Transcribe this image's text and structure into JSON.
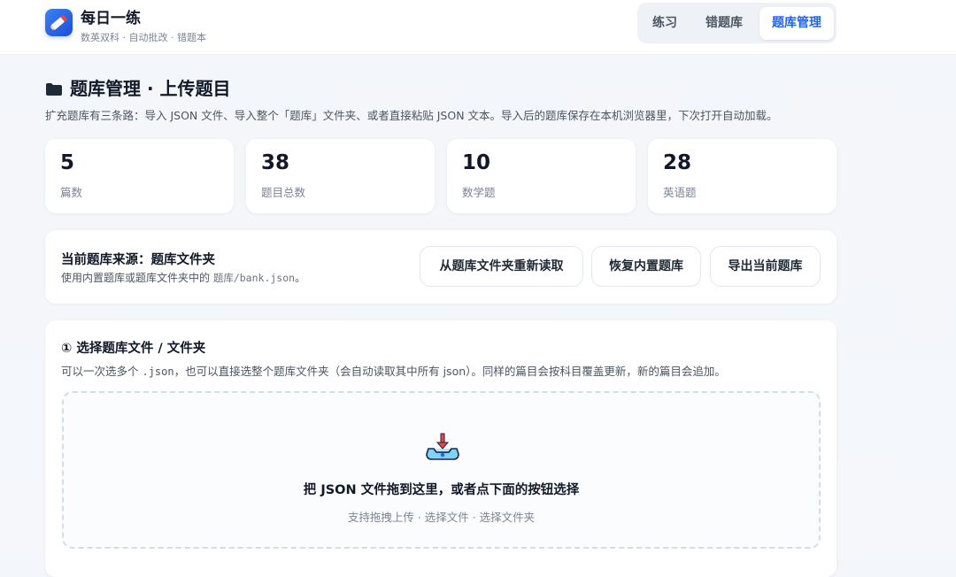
{
  "header": {
    "title": "每日一练",
    "subtitle": "数英双科 · 自动批改 · 错题本",
    "logo_icon": "pencil-icon",
    "tabs": [
      {
        "label": "练习",
        "active": false
      },
      {
        "label": "错题库",
        "active": false
      },
      {
        "label": "题库管理",
        "active": true
      }
    ]
  },
  "page": {
    "icon": "folder-icon",
    "title": "题库管理 · 上传题目",
    "description": "扩充题库有三条路：导入 JSON 文件、导入整个「题库」文件夹、或者直接粘贴 JSON 文本。导入后的题库保存在本机浏览器里，下次打开自动加载。"
  },
  "stats": [
    {
      "value": "5",
      "label": "篇数"
    },
    {
      "value": "38",
      "label": "题目总数"
    },
    {
      "value": "10",
      "label": "数学题"
    },
    {
      "value": "28",
      "label": "英语题"
    }
  ],
  "source": {
    "title": "当前题库来源：题库文件夹",
    "desc_prefix": "使用内置题库或题库文件夹中的 ",
    "desc_path": "题库/bank.json",
    "desc_suffix": "。",
    "buttons": {
      "reload": "从题库文件夹重新读取",
      "restore": "恢复内置题库",
      "export": "导出当前题库"
    }
  },
  "upload": {
    "title": "① 选择题库文件 / 文件夹",
    "desc_prefix": "可以一次选多个 ",
    "desc_ext": ".json",
    "desc_suffix": "，也可以直接选整个题库文件夹（会自动读取其中所有 json）。同样的篇目会按科目覆盖更新，新的篇目会追加。",
    "drop_icon": "inbox-download-icon",
    "drop_main": "把 JSON 文件拖到这里，或者点下面的按钮选择",
    "drop_sub": "支持拖拽上传 · 选择文件 · 选择文件夹"
  },
  "colors": {
    "accent": "#2563eb",
    "background": "#f4f6fa"
  }
}
